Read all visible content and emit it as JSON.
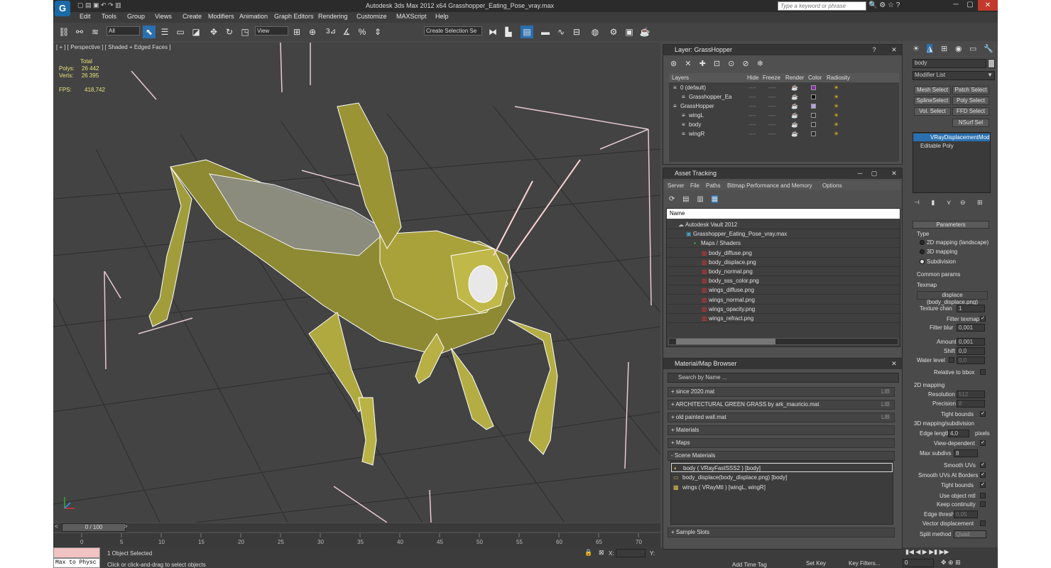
{
  "window": {
    "title": "Autodesk 3ds Max  2012 x64     Grasshopper_Eating_Pose_vray.max",
    "search_placeholder": "Type a keyword or phrase"
  },
  "menu": [
    "Edit",
    "Tools",
    "Group",
    "Views",
    "Create",
    "Modifiers",
    "Animation",
    "Graph Editors",
    "Rendering",
    "Customize",
    "MAXScript",
    "Help"
  ],
  "toolbar": {
    "filter": "All",
    "coord": "View",
    "selection_set": "Create Selection Se"
  },
  "viewport": {
    "label": "[ + ] [ Perspective ] [ Shaded + Edged Faces ]",
    "stats": {
      "total": "Total",
      "polys_label": "Polys:",
      "polys": "26 442",
      "verts_label": "Verts:",
      "verts": "26 395",
      "fps_label": "FPS:",
      "fps": "418,742"
    }
  },
  "timeline": {
    "frame": "0 / 100",
    "ticks": [
      "0",
      "5",
      "10",
      "15",
      "20",
      "25",
      "30",
      "35",
      "40",
      "45",
      "50",
      "55",
      "60",
      "65",
      "70"
    ]
  },
  "status": {
    "objects": "1 Object Selected",
    "hint": "Click or click-and-drag to select objects",
    "maxscript": "Max to Physc",
    "add_time_tag": "Add Time Tag",
    "set_key": "Set Key",
    "key_filters": "Key Filters...",
    "frame": "0",
    "x": "X:",
    "y": "Y:"
  },
  "layer_panel": {
    "title": "Layer: GrassHopper",
    "columns": [
      "Layers",
      "Hide",
      "Freeze",
      "Render",
      "Color",
      "Radiosity"
    ],
    "rows": [
      {
        "name": "0 (default)",
        "indent": 0,
        "color": "#8b2fb0"
      },
      {
        "name": "Grasshopper_Ea",
        "indent": 1,
        "color": "#111111"
      },
      {
        "name": "GrassHopper",
        "indent": 0,
        "color": "#b4a0e6"
      },
      {
        "name": "wingL",
        "indent": 1,
        "color": "#303030"
      },
      {
        "name": "body",
        "indent": 1,
        "color": "#303030"
      },
      {
        "name": "wingR",
        "indent": 1,
        "color": "#303030"
      }
    ],
    "hide_mark": "----",
    "freeze_mark": "----"
  },
  "asset_panel": {
    "title": "Asset Tracking",
    "menu": [
      "Server",
      "File",
      "Paths",
      "Bitmap Performance and Memory",
      "Options"
    ],
    "column": "Name",
    "rows": [
      {
        "name": "Autodesk Vault 2012",
        "indent": 0
      },
      {
        "name": "Grasshopper_Eating_Pose_vray.max",
        "indent": 1
      },
      {
        "name": "Maps / Shaders",
        "indent": 2
      },
      {
        "name": "body_diffuse.png",
        "indent": 3
      },
      {
        "name": "body_displace.png",
        "indent": 3
      },
      {
        "name": "body_normal.png",
        "indent": 3
      },
      {
        "name": "body_sss_color.png",
        "indent": 3
      },
      {
        "name": "wings_diffuse.png",
        "indent": 3
      },
      {
        "name": "wings_normal.png",
        "indent": 3
      },
      {
        "name": "wings_opacity.png",
        "indent": 3
      },
      {
        "name": "wings_refract.png",
        "indent": 3
      }
    ]
  },
  "material_panel": {
    "title": "Material/Map Browser",
    "search": "Search by Name ...",
    "groups": [
      {
        "name": "+ since 2020.mat",
        "tag": "LIB"
      },
      {
        "name": "+ ARCHITECTURAL GREEN GRASS by ark_mauricio.mat",
        "tag": "LIB"
      },
      {
        "name": "+ old painted wall.mat",
        "tag": "LIB"
      },
      {
        "name": "+ Materials",
        "tag": ""
      },
      {
        "name": "+ Maps",
        "tag": ""
      },
      {
        "name": "- Scene Materials",
        "tag": ""
      }
    ],
    "scene_materials": [
      "body  ( VRayFastSSS2 )  [body]",
      "body_displace(body_displace.png) [body]",
      "wings  ( VRayMtl )  [wingL, wingR]"
    ],
    "sample_slots": "+ Sample Slots"
  },
  "cmd_panel": {
    "object_name": "body",
    "modifier_list": "Modifier List",
    "buttons": [
      "Mesh Select",
      "Patch Select",
      "SplineSelect",
      "Poly Select",
      "Vol. Select",
      "FFD Select",
      "NSurf Sel"
    ],
    "stack": [
      "VRayDisplacementMod",
      "Editable Poly"
    ],
    "rollout": "Parameters",
    "type_label": "Type",
    "types": [
      "2D mapping (landscape)",
      "3D mapping",
      "Subdivision"
    ],
    "common": "Common params",
    "texmap": "Texmap",
    "texmap_value": "displace (body_displace.png)",
    "texture_chan": "Texture chan",
    "texture_chan_val": "1",
    "filter_texmap": "Filter texmap",
    "filter_blur": "Filter blur",
    "filter_blur_val": "0,001",
    "amount": "Amount",
    "amount_val": "0,001",
    "shift": "Shift",
    "shift_val": "0,0",
    "water_level": "Water level",
    "water_level_val": "0,0",
    "relative": "Relative to bbox",
    "mapping2d": "2D mapping",
    "resolution": "Resolution",
    "resolution_val": "512",
    "precision": "Precision",
    "precision_val": "8",
    "tight_bounds": "Tight bounds",
    "mapping3d": "3D mapping/subdivision",
    "edge_length": "Edge length",
    "edge_length_val": "4,0",
    "pixels": "pixels",
    "view_dependent": "View-dependent",
    "max_subdivs": "Max subdivs",
    "max_subdivs_val": "8",
    "smooth_uvs": "Smooth UVs",
    "smooth_uvs_borders": "Smooth UVs At Borders",
    "tight_bounds2": "Tight bounds",
    "use_object_mtl": "Use object mtl",
    "keep_continuity": "Keep continuity",
    "edge_thresh": "Edge thresh",
    "edge_thresh_val": "0,05",
    "vector_disp": "Vector displacement",
    "split_method": "Split method",
    "split_method_val": "Quad"
  }
}
